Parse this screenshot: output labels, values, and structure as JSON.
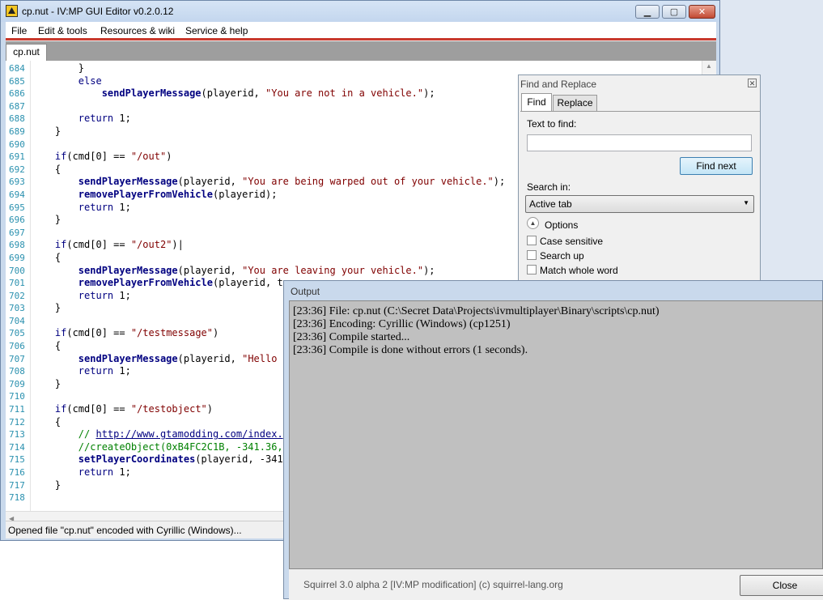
{
  "window": {
    "title": "cp.nut - IV:MP GUI Editor v0.2.0.12",
    "minimize": "▁",
    "maximize": "▢",
    "close": "✕"
  },
  "menu": [
    "File",
    "Edit & tools",
    "Resources & wiki",
    "Service & help"
  ],
  "tabs": [
    {
      "label": "cp.nut"
    }
  ],
  "editor": {
    "lines": [
      {
        "n": "684",
        "t": "        }"
      },
      {
        "n": "685",
        "t": "        else"
      },
      {
        "n": "686",
        "t": "            sendPlayerMessage(playerid, \"You are not in a vehicle.\");"
      },
      {
        "n": "687",
        "t": ""
      },
      {
        "n": "688",
        "t": "        return 1;"
      },
      {
        "n": "689",
        "t": "    }"
      },
      {
        "n": "690",
        "t": ""
      },
      {
        "n": "691",
        "t": "    if(cmd[0] == \"/out\")"
      },
      {
        "n": "692",
        "t": "    {"
      },
      {
        "n": "693",
        "t": "        sendPlayerMessage(playerid, \"You are being warped out of your vehicle.\");"
      },
      {
        "n": "694",
        "t": "        removePlayerFromVehicle(playerid);"
      },
      {
        "n": "695",
        "t": "        return 1;"
      },
      {
        "n": "696",
        "t": "    }"
      },
      {
        "n": "697",
        "t": ""
      },
      {
        "n": "698",
        "t": "    if(cmd[0] == \"/out2\")|"
      },
      {
        "n": "699",
        "t": "    {"
      },
      {
        "n": "700",
        "t": "        sendPlayerMessage(playerid, \"You are leaving your vehicle.\");"
      },
      {
        "n": "701",
        "t": "        removePlayerFromVehicle(playerid, t"
      },
      {
        "n": "702",
        "t": "        return 1;"
      },
      {
        "n": "703",
        "t": "    }"
      },
      {
        "n": "704",
        "t": ""
      },
      {
        "n": "705",
        "t": "    if(cmd[0] == \"/testmessage\")"
      },
      {
        "n": "706",
        "t": "    {"
      },
      {
        "n": "707",
        "t": "        sendPlayerMessage(playerid, \"Hello "
      },
      {
        "n": "708",
        "t": "        return 1;"
      },
      {
        "n": "709",
        "t": "    }"
      },
      {
        "n": "710",
        "t": ""
      },
      {
        "n": "711",
        "t": "    if(cmd[0] == \"/testobject\")"
      },
      {
        "n": "712",
        "t": "    {"
      },
      {
        "n": "713",
        "t": "        // http://www.gtamodding.com/index."
      },
      {
        "n": "714",
        "t": "        //createObject(0xB4FC2C1B, -341.36,"
      },
      {
        "n": "715",
        "t": "        setPlayerCoordinates(playerid, -341"
      },
      {
        "n": "716",
        "t": "        return 1;"
      },
      {
        "n": "717",
        "t": "    }"
      },
      {
        "n": "718",
        "t": ""
      }
    ]
  },
  "status": "Opened file \"cp.nut\" encoded with Cyrillic (Windows)...",
  "find_replace": {
    "title": "Find and Replace",
    "tab_find": "Find",
    "tab_replace": "Replace",
    "text_to_find_label": "Text to find:",
    "text_to_find_value": "",
    "find_next": "Find next",
    "search_in_label": "Search in:",
    "search_in_value": "Active tab",
    "options_label": "Options",
    "case_sensitive": "Case sensitive",
    "search_up": "Search up",
    "match_whole_word": "Match whole word"
  },
  "output": {
    "title": "Output",
    "lines": [
      "[23:36] File: cp.nut (C:\\Secret Data\\Projects\\ivmultiplayer\\Binary\\scripts\\cp.nut)",
      "[23:36] Encoding: Cyrillic (Windows) (cp1251)",
      "[23:36] Compile started...",
      "[23:36] Compile is done without errors (1 seconds)."
    ],
    "footer": "Squirrel 3.0 alpha 2 [IV:MP modification] (c) squirrel-lang.org",
    "close": "Close"
  }
}
